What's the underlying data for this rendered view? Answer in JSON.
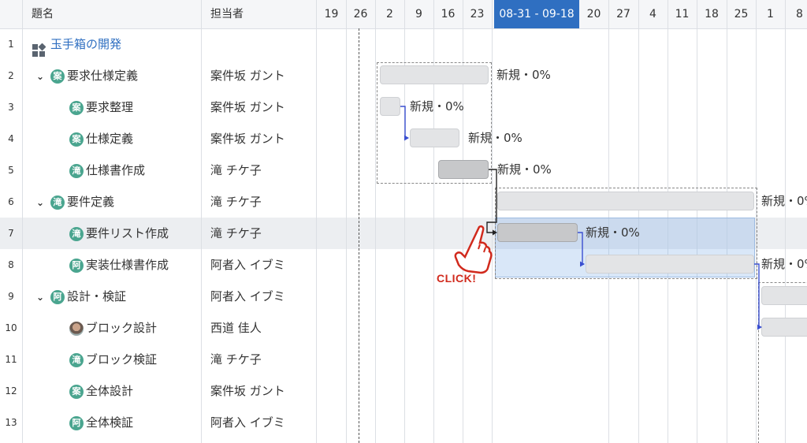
{
  "header": {
    "title_col": "題名",
    "owner_col": "担当者",
    "dates": [
      "19",
      "26",
      "2",
      "9",
      "16",
      "23",
      "08-31 - 09-18",
      "20",
      "27",
      "4",
      "11",
      "18",
      "25",
      "1",
      "8"
    ]
  },
  "rows": [
    {
      "num": "1",
      "title": "玉手箱の開発",
      "owner": "",
      "avatar": "",
      "type": "project"
    },
    {
      "num": "2",
      "title": "要求仕様定義",
      "owner": "案件坂 ガント",
      "avatar": "案",
      "type": "parent"
    },
    {
      "num": "3",
      "title": "要求整理",
      "owner": "案件坂 ガント",
      "avatar": "案",
      "type": "child"
    },
    {
      "num": "4",
      "title": "仕様定義",
      "owner": "案件坂 ガント",
      "avatar": "案",
      "type": "child"
    },
    {
      "num": "5",
      "title": "仕様書作成",
      "owner": "滝 チケ子",
      "avatar": "滝",
      "type": "child"
    },
    {
      "num": "6",
      "title": "要件定義",
      "owner": "滝 チケ子",
      "avatar": "滝",
      "type": "parent"
    },
    {
      "num": "7",
      "title": "要件リスト作成",
      "owner": "滝 チケ子",
      "avatar": "滝",
      "type": "child"
    },
    {
      "num": "8",
      "title": "実装仕様書作成",
      "owner": "阿者入 イブミ",
      "avatar": "阿",
      "type": "child"
    },
    {
      "num": "9",
      "title": "設計・検証",
      "owner": "阿者入 イブミ",
      "avatar": "阿",
      "type": "parent"
    },
    {
      "num": "10",
      "title": "ブロック設計",
      "owner": "西道 佳人",
      "avatar": "",
      "type": "child-photo"
    },
    {
      "num": "11",
      "title": "ブロック検証",
      "owner": "滝 チケ子",
      "avatar": "滝",
      "type": "child"
    },
    {
      "num": "12",
      "title": "全体設計",
      "owner": "案件坂 ガント",
      "avatar": "案",
      "type": "child"
    },
    {
      "num": "13",
      "title": "全体検証",
      "owner": "阿者入 イブミ",
      "avatar": "阿",
      "type": "child"
    }
  ],
  "bar_label": "新規・0%",
  "click_label": "CLICK!",
  "colors": {
    "accent": "#2f6fc1",
    "avatar": "#4aa58f",
    "link": "#3a4fd0"
  }
}
